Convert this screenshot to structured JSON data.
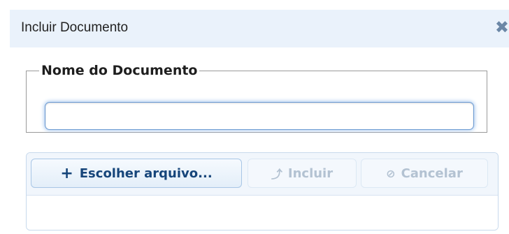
{
  "dialog": {
    "title": "Incluir Documento",
    "close_icon": "close-icon"
  },
  "document_name": {
    "legend": "Nome do Documento",
    "value": ""
  },
  "upload": {
    "choose_label": "Escolher arquivo...",
    "choose_icon": "plus-icon",
    "include_label": "Incluir",
    "include_icon": "upload-arrow-icon",
    "cancel_label": "Cancelar",
    "cancel_icon": "cancel-circle-icon"
  },
  "colors": {
    "titlebar_bg": "#eaf2fb",
    "primary_text": "#16457a",
    "disabled_text": "#b3c2d2",
    "focus_ring": "#a9c9ef"
  }
}
